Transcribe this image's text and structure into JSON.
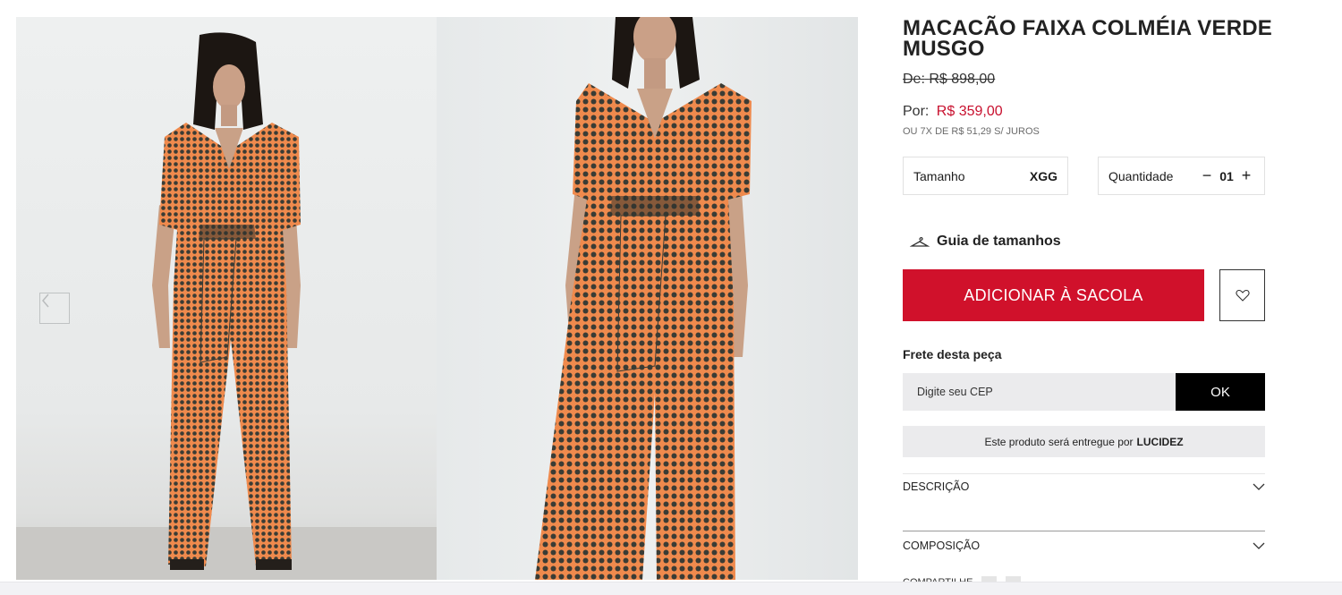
{
  "product": {
    "title": "MACACÃO FAIXA COLMÉIA VERDE MUSGO",
    "old_price_label": "De:",
    "old_price": "R$ 898,00",
    "price_label": "Por:",
    "price": "R$ 359,00",
    "installments": "OU 7X DE R$ 51,29 S/ JUROS"
  },
  "options": {
    "size_label": "Tamanho",
    "size_value": "XGG",
    "quantity_label": "Quantidade",
    "quantity_minus": "−",
    "quantity_value": "01",
    "quantity_plus": "+"
  },
  "size_guide_label": "Guia de tamanhos",
  "add_to_bag_label": "ADICIONAR À SACOLA",
  "shipping": {
    "label": "Frete desta peça",
    "cep_placeholder": "Digite seu CEP",
    "ok_label": "OK"
  },
  "seller": {
    "text": "Este produto será entregue por",
    "name": "LUCIDEZ"
  },
  "accordion": {
    "description_label": "DESCRIÇÃO",
    "composition_label": "COMPOSIÇÃO"
  },
  "share_label": "COMPARTILHE",
  "icons": {
    "prev": "chevron-left-icon",
    "next": "chevron-right-icon",
    "hanger": "hanger-icon",
    "wishlist": "heart-icon",
    "expand": "chevron-down-icon"
  },
  "colors": {
    "accent_red": "#d0112b",
    "price_red": "#c8102e",
    "ok_black": "#000000",
    "field_gray": "#ebebed",
    "print_orange": "#ef8a4d",
    "print_dark": "#3a3c35"
  }
}
